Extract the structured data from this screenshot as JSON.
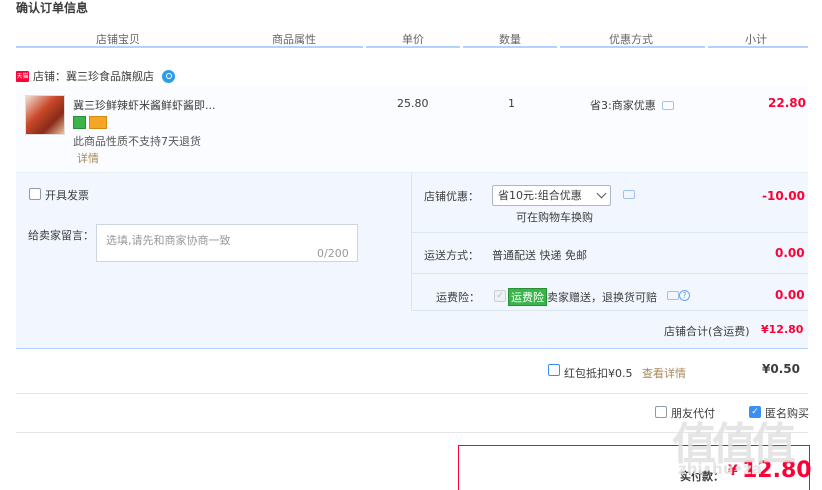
{
  "page": {
    "title": "确认订单信息"
  },
  "columns": [
    "店铺宝贝",
    "商品属性",
    "单价",
    "数量",
    "优惠方式",
    "小计"
  ],
  "shop": {
    "label": "店铺：冀三珍食品旗舰店",
    "tmall_badge": "天猫"
  },
  "item": {
    "name": "冀三珍鲜辣虾米酱鲜虾酱即...",
    "price": "25.80",
    "quantity": "1",
    "discount": "省3:商家优惠",
    "subtotal": "22.80",
    "no_return": "此商品性质不支持7天退货",
    "details": "详情"
  },
  "invoice": {
    "label": "开具发票"
  },
  "message": {
    "label": "给卖家留言：",
    "placeholder": "选填,请先和商家协商一致",
    "count": "0/200"
  },
  "shop_discount": {
    "label": "店铺优惠：",
    "selected": "省10元:组合优惠",
    "note": "可在购物车换购",
    "amount": "-10.00"
  },
  "shipping": {
    "label": "运送方式：",
    "value": "普通配送 快递 免邮",
    "amount": "0.00"
  },
  "insurance": {
    "label": "运费险：",
    "tag": "运费险",
    "text": "卖家赠送，退换货可赔",
    "amount": "0.00"
  },
  "shop_total": {
    "label": "店铺合计(含运费)",
    "amount": "¥12.80"
  },
  "red_packet": {
    "label": "红包抵扣¥0.5",
    "link": "查看详情",
    "amount": "¥0.50"
  },
  "extra": {
    "friend_pay": "朋友代付",
    "anonymous": "匿名购买"
  },
  "pay": {
    "label": "实付款：",
    "currency": "¥",
    "amount": "12.80"
  },
  "watermark": {
    "logo": "值值值",
    "site": "zhi•hu•za"
  }
}
